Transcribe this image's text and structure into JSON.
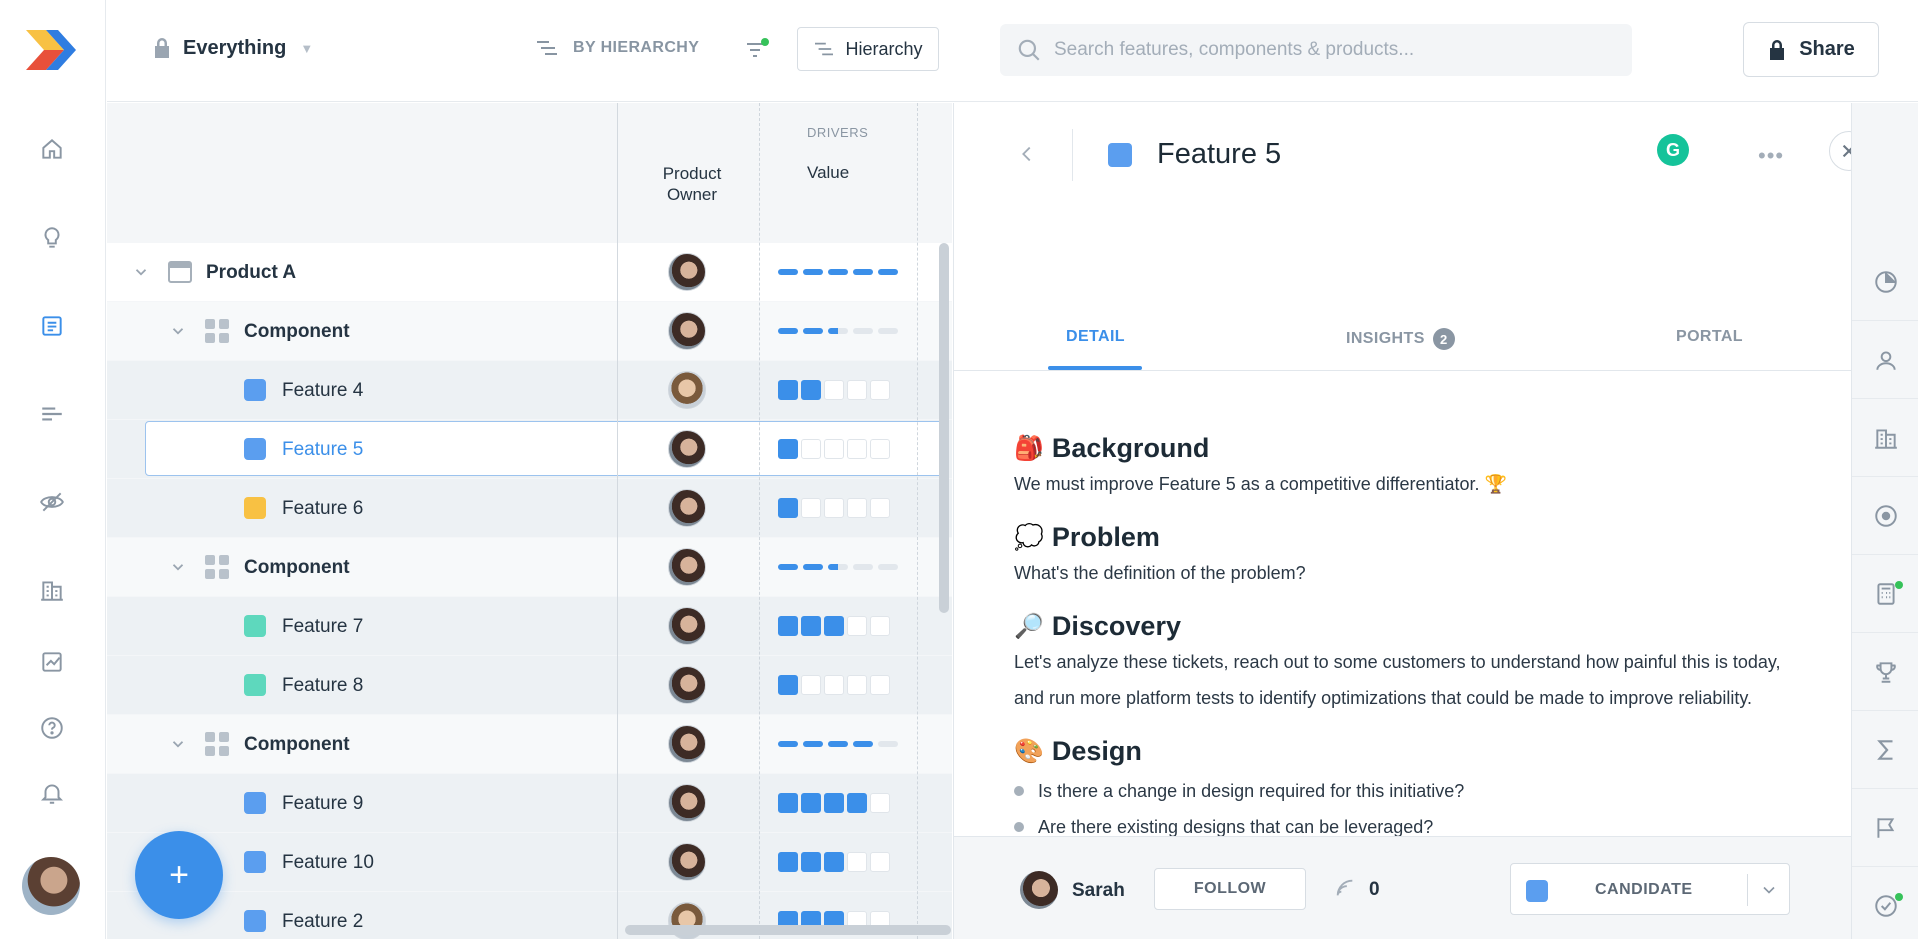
{
  "topbar": {
    "scope_label": "Everything",
    "group_by_label": "BY HIERARCHY",
    "hierarchy_button_label": "Hierarchy",
    "search_placeholder": "Search features, components & products...",
    "share_label": "Share"
  },
  "grid": {
    "drivers_label": "DRIVERS",
    "owner_header": "Product Owner",
    "value_header": "Value",
    "rows": [
      {
        "name": "Product A",
        "level": 0,
        "type": "product",
        "value": 5,
        "max": 5,
        "style": "dash"
      },
      {
        "name": "Component",
        "level": 1,
        "type": "component",
        "value": 2.5,
        "max": 5,
        "style": "dash"
      },
      {
        "name": "Feature 4",
        "level": 2,
        "type": "feature",
        "color": "#5b9eef",
        "value": 2,
        "max": 5,
        "style": "box"
      },
      {
        "name": "Feature 5",
        "level": 2,
        "type": "feature",
        "color": "#5b9eef",
        "value": 1,
        "max": 5,
        "style": "box",
        "selected": true
      },
      {
        "name": "Feature 6",
        "level": 2,
        "type": "feature",
        "color": "#f8c143",
        "value": 1,
        "max": 5,
        "style": "box"
      },
      {
        "name": "Component",
        "level": 1,
        "type": "component",
        "value": 2.5,
        "max": 5,
        "style": "dash"
      },
      {
        "name": "Feature 7",
        "level": 2,
        "type": "feature",
        "color": "#5ed8bd",
        "value": 3,
        "max": 5,
        "style": "box"
      },
      {
        "name": "Feature 8",
        "level": 2,
        "type": "feature",
        "color": "#5ed8bd",
        "value": 1,
        "max": 5,
        "style": "box"
      },
      {
        "name": "Component",
        "level": 1,
        "type": "component",
        "value": 4,
        "max": 5,
        "style": "dash"
      },
      {
        "name": "Feature 9",
        "level": 2,
        "type": "feature",
        "color": "#5b9eef",
        "value": 4,
        "max": 5,
        "style": "box"
      },
      {
        "name": "Feature 10",
        "level": 2,
        "type": "feature",
        "color": "#5b9eef",
        "value": 3,
        "max": 5,
        "style": "box"
      },
      {
        "name": "Feature 2",
        "level": 2,
        "type": "feature",
        "color": "#5b9eef",
        "value": 3,
        "max": 5,
        "style": "box"
      }
    ]
  },
  "panel": {
    "title": "Feature 5",
    "grammarly_label": "G",
    "more_label": "•••",
    "tabs": [
      {
        "label": "DETAIL",
        "active": true
      },
      {
        "label": "INSIGHTS",
        "badge": "2"
      },
      {
        "label": "PORTAL"
      }
    ],
    "sections": {
      "background": {
        "emoji": "🎒",
        "title": "Background",
        "text": "We must improve Feature 5 as a competitive differentiator. 🏆"
      },
      "problem": {
        "emoji": "💭",
        "title": "Problem",
        "text": "What's the definition of the problem?"
      },
      "discovery": {
        "emoji": "🔎",
        "title": "Discovery",
        "text": "Let's analyze these tickets, reach out to some customers to understand how painful this is today, and run more platform tests to identify optimizations that could be made to improve reliability."
      },
      "design": {
        "emoji": "🎨",
        "title": "Design",
        "bullets": [
          "Is there a change in design required for this initiative?",
          "Are there existing designs that can be leveraged?"
        ]
      }
    },
    "footer": {
      "owner_name": "Sarah",
      "follow_label": "FOLLOW",
      "feed_count": "0",
      "status_label": "CANDIDATE",
      "status_color": "#5b9eef"
    }
  },
  "fab_label": "+",
  "colors": {
    "accent": "#3b8fe9",
    "success": "#36c25a"
  }
}
